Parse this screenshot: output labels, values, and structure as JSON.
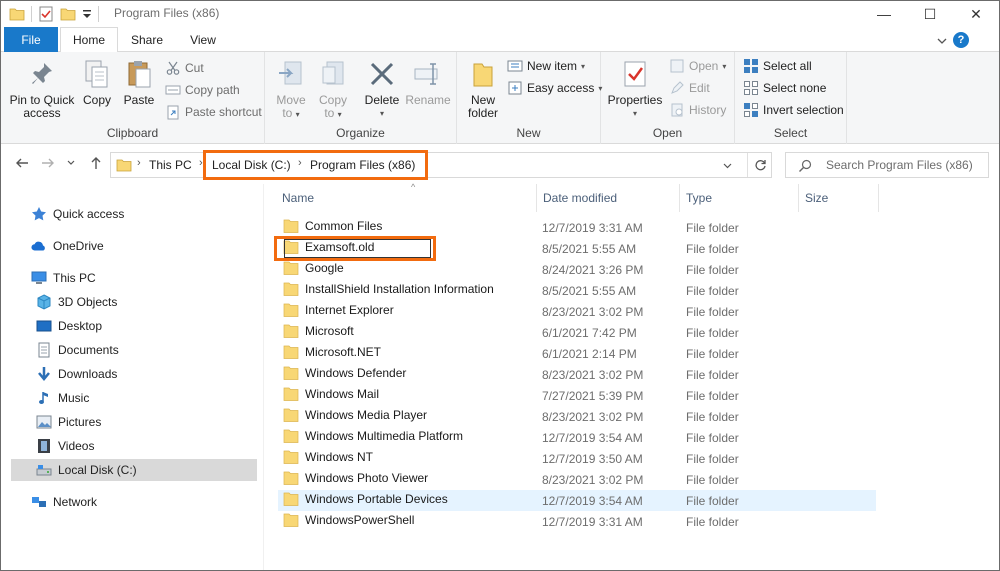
{
  "window": {
    "title": "Program Files (x86)",
    "controls": {
      "minimize": "—",
      "maximize": "☐",
      "close": "✕"
    }
  },
  "tabs": {
    "file": "File",
    "home": "Home",
    "share": "Share",
    "view": "View",
    "help": "?"
  },
  "ribbon": {
    "clipboard": {
      "label": "Clipboard",
      "pin": "Pin to Quick access",
      "pin_l1": "Pin to Quick",
      "pin_l2": "access",
      "copy": "Copy",
      "paste": "Paste",
      "cut": "Cut",
      "copy_path": "Copy path",
      "paste_shortcut": "Paste shortcut"
    },
    "organize": {
      "label": "Organize",
      "move_l1": "Move",
      "move_l2": "to",
      "copy_l1": "Copy",
      "copy_l2": "to",
      "delete": "Delete",
      "rename": "Rename"
    },
    "new": {
      "label": "New",
      "new_folder_l1": "New",
      "new_folder_l2": "folder",
      "new_item": "New item",
      "easy_access": "Easy access"
    },
    "open": {
      "label": "Open",
      "properties": "Properties",
      "open": "Open",
      "edit": "Edit",
      "history": "History"
    },
    "select": {
      "label": "Select",
      "select_all": "Select all",
      "select_none": "Select none",
      "invert": "Invert selection"
    }
  },
  "address": {
    "seg1": "This PC",
    "seg2": "Local Disk (C:)",
    "seg3": "Program Files (x86)",
    "search_placeholder": "Search Program Files (x86)"
  },
  "nav": {
    "quick_access": "Quick access",
    "onedrive": "OneDrive",
    "this_pc": "This PC",
    "objects3d": "3D Objects",
    "desktop": "Desktop",
    "documents": "Documents",
    "downloads": "Downloads",
    "music": "Music",
    "pictures": "Pictures",
    "videos": "Videos",
    "local_disk": "Local Disk (C:)",
    "network": "Network"
  },
  "columns": {
    "name": "Name",
    "date": "Date modified",
    "type": "Type",
    "size": "Size"
  },
  "files": [
    {
      "name": "Common Files",
      "date": "12/7/2019 3:31 AM",
      "type": "File folder"
    },
    {
      "name": "Examsoft.old",
      "date": "8/5/2021 5:55 AM",
      "type": "File folder"
    },
    {
      "name": "Google",
      "date": "8/24/2021 3:26 PM",
      "type": "File folder"
    },
    {
      "name": "InstallShield Installation Information",
      "date": "8/5/2021 5:55 AM",
      "type": "File folder"
    },
    {
      "name": "Internet Explorer",
      "date": "8/23/2021 3:02 PM",
      "type": "File folder"
    },
    {
      "name": "Microsoft",
      "date": "6/1/2021 7:42 PM",
      "type": "File folder"
    },
    {
      "name": "Microsoft.NET",
      "date": "6/1/2021 2:14 PM",
      "type": "File folder"
    },
    {
      "name": "Windows Defender",
      "date": "8/23/2021 3:02 PM",
      "type": "File folder"
    },
    {
      "name": "Windows Mail",
      "date": "7/27/2021 5:39 PM",
      "type": "File folder"
    },
    {
      "name": "Windows Media Player",
      "date": "8/23/2021 3:02 PM",
      "type": "File folder"
    },
    {
      "name": "Windows Multimedia Platform",
      "date": "12/7/2019 3:54 AM",
      "type": "File folder"
    },
    {
      "name": "Windows NT",
      "date": "12/7/2019 3:50 AM",
      "type": "File folder"
    },
    {
      "name": "Windows Photo Viewer",
      "date": "8/23/2021 3:02 PM",
      "type": "File folder"
    },
    {
      "name": "Windows Portable Devices",
      "date": "12/7/2019 3:54 AM",
      "type": "File folder"
    },
    {
      "name": "WindowsPowerShell",
      "date": "12/7/2019 3:31 AM",
      "type": "File folder"
    }
  ],
  "colors": {
    "accent": "#1979ca",
    "highlight": "#f26b0f",
    "folder": "#f8d775",
    "hover_row": "#e5f3ff"
  }
}
